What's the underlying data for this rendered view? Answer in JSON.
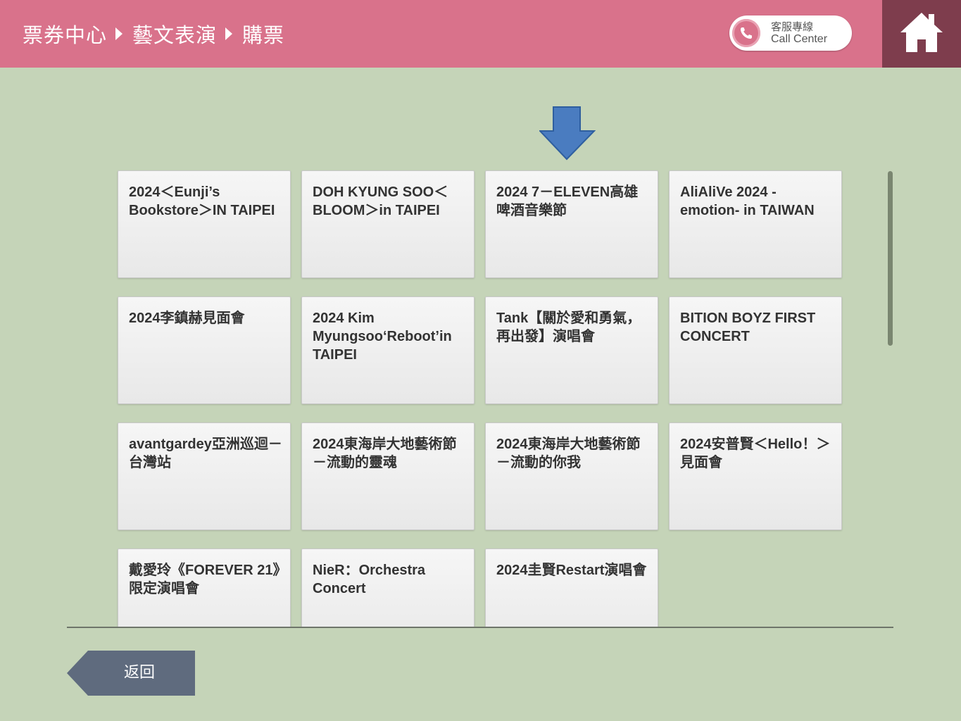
{
  "header": {
    "breadcrumb": [
      "票券中心",
      "藝文表演",
      "購票"
    ],
    "call_center": {
      "zh": "客服專線",
      "en": "Call Center"
    },
    "home_icon": "home-icon"
  },
  "events": [
    "2024＜Eunji’s Bookstore＞IN TAIPEI",
    "DOH KYUNG SOO＜BLOOM＞in TAIPEI",
    "2024 7－ELEVEN高雄啤酒音樂節",
    "AliAliVe 2024 -emotion- in TAIWAN",
    "2024李鎮赫見面會",
    "2024 Kim Myungsoo‘Reboot’in TAIPEI",
    "Tank【關於愛和勇氣，再出發】演唱會",
    "BITION BOYZ FIRST CONCERT",
    "avantgardey亞洲巡迴－台灣站",
    "2024東海岸大地藝術節－流動的靈魂",
    "2024東海岸大地藝術節－流動的你我",
    "2024安普賢＜Hello！＞見面會",
    "戴愛玲《FOREVER 21》限定演唱會",
    "NieR：Orchestra Concert",
    "2024圭賢Restart演唱會"
  ],
  "footer": {
    "back_label": "返回"
  },
  "colors": {
    "header_bg": "#d9728b",
    "home_bg": "#7e3d4d",
    "page_bg": "#c5d4b8",
    "arrow": "#4a7cc0",
    "back_btn": "#5f6b7e"
  }
}
